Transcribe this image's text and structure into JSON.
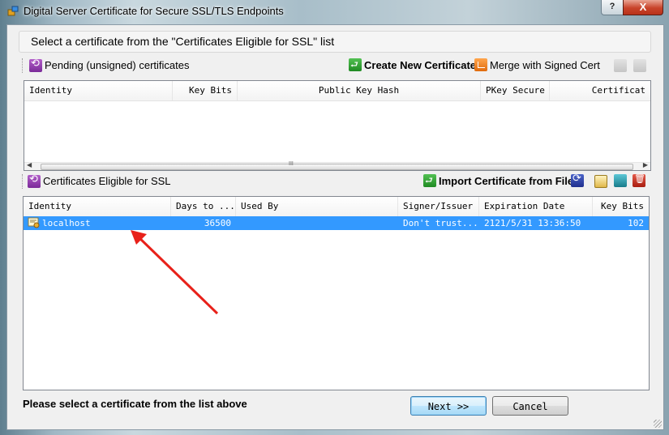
{
  "window": {
    "title": "Digital Server Certificate for Secure SSL/TLS Endpoints",
    "help_label": "?",
    "close_label": "X"
  },
  "header": {
    "instruction": "Select a certificate from the \"Certificates Eligible for SSL\" list"
  },
  "pending": {
    "label": "Pending (unsigned) certificates",
    "create_label": "Create New Certificate",
    "merge_label": "Merge with Signed Cert",
    "columns": [
      "Identity",
      "Key Bits",
      "Public Key Hash",
      "PKey Secure",
      "Certificat"
    ],
    "scroll_grip": "III"
  },
  "eligible": {
    "label": "Certificates Eligible for SSL",
    "import_label": "Import Certificate from File",
    "columns": [
      "Identity",
      "Days to ...",
      "Used By",
      "Signer/Issuer",
      "Expiration Date",
      "Key Bits"
    ],
    "rows": [
      {
        "identity": "localhost",
        "days": "36500",
        "used_by": "",
        "signer": "Don't trust...",
        "expiration": "2121/5/31 13:36:50",
        "key_bits": "102"
      }
    ]
  },
  "footer": {
    "status": "Please select a certificate from the list above",
    "next_label": "Next >>",
    "cancel_label": "Cancel"
  },
  "colors": {
    "selection": "#3399ff",
    "arrow": "#e8211a"
  },
  "icons": [
    "certificate-app-icon",
    "refresh-icon",
    "create-certificate-icon",
    "merge-icon",
    "certificate-disabled-icon",
    "delete-disabled-icon",
    "import-icon",
    "refresh-blue-icon",
    "certificate-icon",
    "export-icon",
    "delete-icon",
    "certificate-row-icon"
  ]
}
